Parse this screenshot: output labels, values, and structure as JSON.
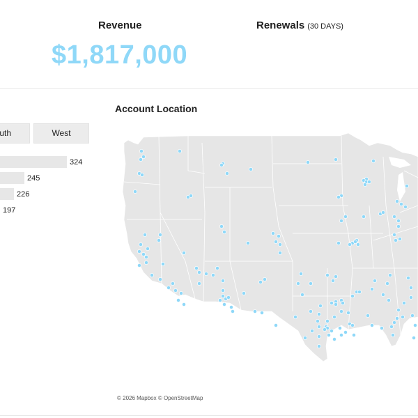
{
  "kpis": {
    "revenue_title": "Revenue",
    "revenue_value": "$1,817,000",
    "renewals_title": "Renewals",
    "renewals_subtitle": "(30 DAYS)"
  },
  "region_tabs": [
    {
      "label": "outh"
    },
    {
      "label": "West"
    }
  ],
  "bars": [
    {
      "value": 324
    },
    {
      "value": 245
    },
    {
      "value": 226
    },
    {
      "value": 197
    }
  ],
  "map": {
    "title": "Account Location",
    "attribution": "© 2026 Mapbox © OpenStreetMap",
    "marker_color": "#8fd8f8",
    "land_color": "#e6e6e6"
  },
  "colors": {
    "accent": "#8fd8f8"
  }
}
